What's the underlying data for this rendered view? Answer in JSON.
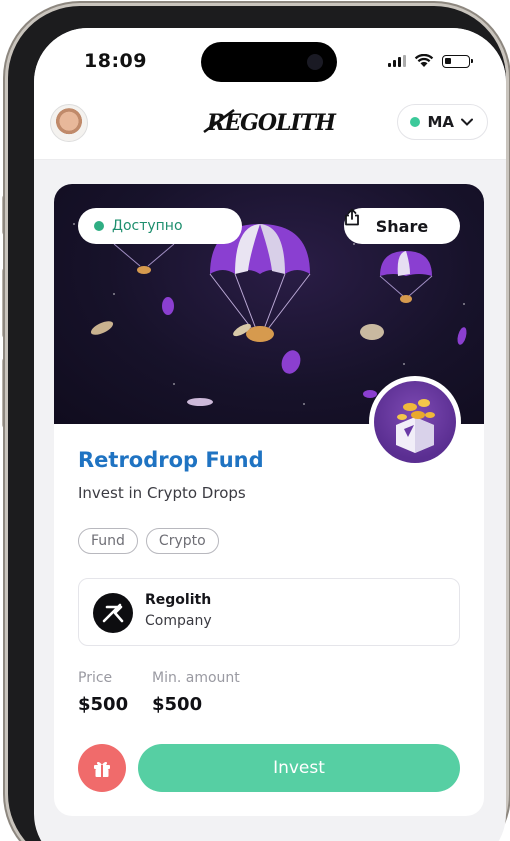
{
  "status_bar": {
    "time": "18:09"
  },
  "header": {
    "logo_text": "REGOLITH",
    "region_label": "MA",
    "region_status_color": "#3cc99a"
  },
  "card": {
    "status_pill": "Доступно",
    "share_label": "Share",
    "title": "Retrodrop Fund",
    "subtitle": "Invest in Crypto Drops",
    "tags": [
      "Fund",
      "Crypto"
    ],
    "company": {
      "name": "Regolith",
      "type": "Company"
    },
    "price": {
      "label": "Price",
      "value": "$500"
    },
    "min_amount": {
      "label": "Min. amount",
      "value": "$500"
    },
    "invest_label": "Invest"
  },
  "colors": {
    "accent_blue": "#1f73c2",
    "invest_green": "#56cfa3",
    "gift_red": "#f06b6b",
    "status_green": "#1e8f6e"
  },
  "icons": {
    "share": "share-icon",
    "gift": "gift-icon",
    "dropdown": "chevron-down-icon"
  }
}
